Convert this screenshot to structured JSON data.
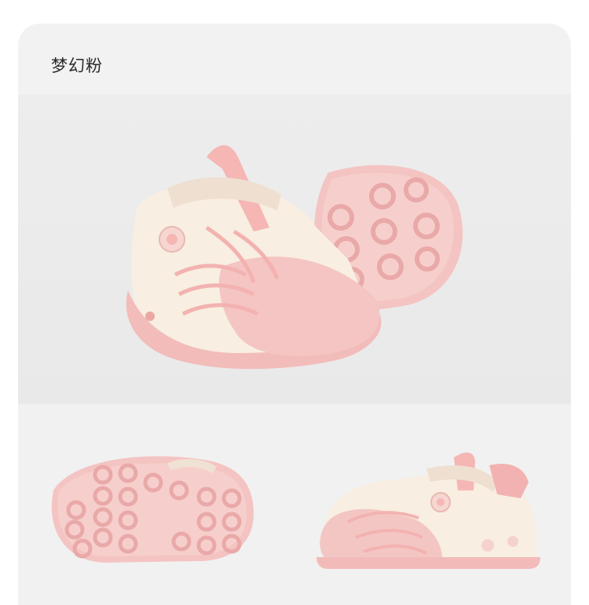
{
  "header": {
    "color_name": "梦幻粉"
  },
  "colors": {
    "background": "#f2f2f2",
    "sole_pink": "#f3c2c0",
    "upper_cream": "#f7eddf",
    "strap_pink": "#f5b5b5"
  },
  "images": {
    "hero": "pink-shoe-hero-photo",
    "sole": "shoe-sole-photo",
    "side": "shoe-side-photo"
  }
}
